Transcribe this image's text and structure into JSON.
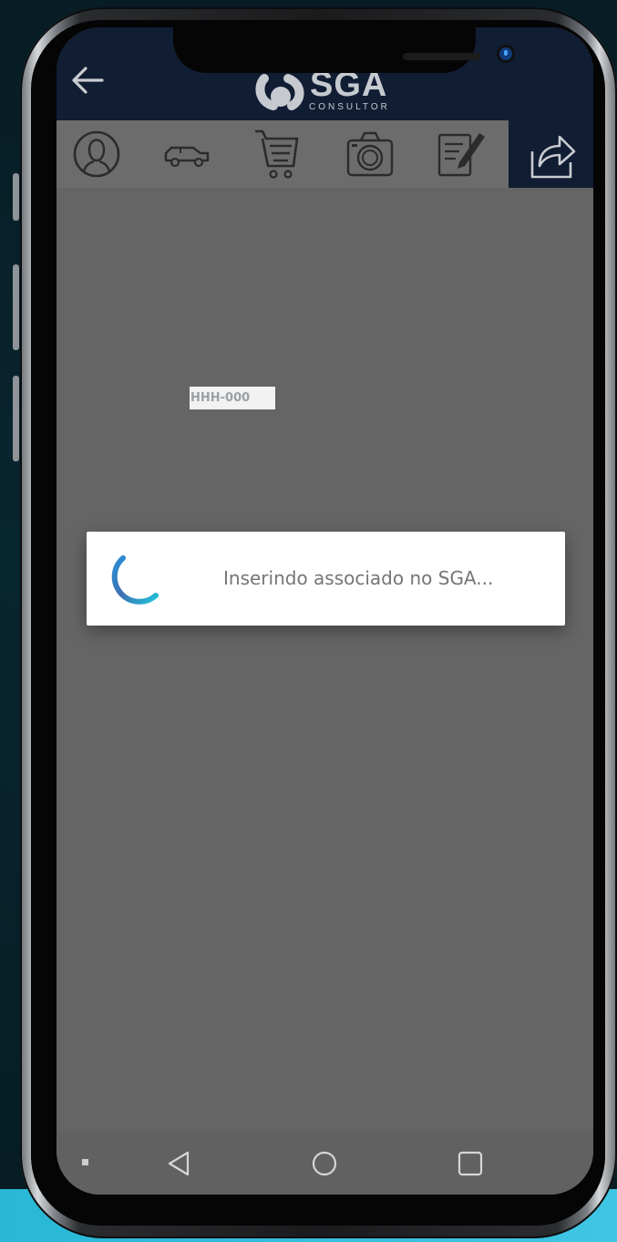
{
  "header": {
    "back_icon": "arrow-left-icon",
    "logo_text": "SGA",
    "logo_subtext": "CONSULTOR",
    "header_color": "#101d33"
  },
  "toolbar": {
    "icons": [
      "user-profile-icon",
      "car-icon",
      "shopping-cart-icon",
      "camera-icon",
      "edit-document-icon"
    ],
    "share_icon": "share-icon"
  },
  "main": {
    "plate_value": "HHH-000"
  },
  "dialog": {
    "message": "Inserindo associado no SGA...",
    "spinner_color": "#29a3d8"
  },
  "navbar": {
    "buttons": [
      "nav-back-icon",
      "nav-home-icon",
      "nav-recents-icon"
    ]
  }
}
